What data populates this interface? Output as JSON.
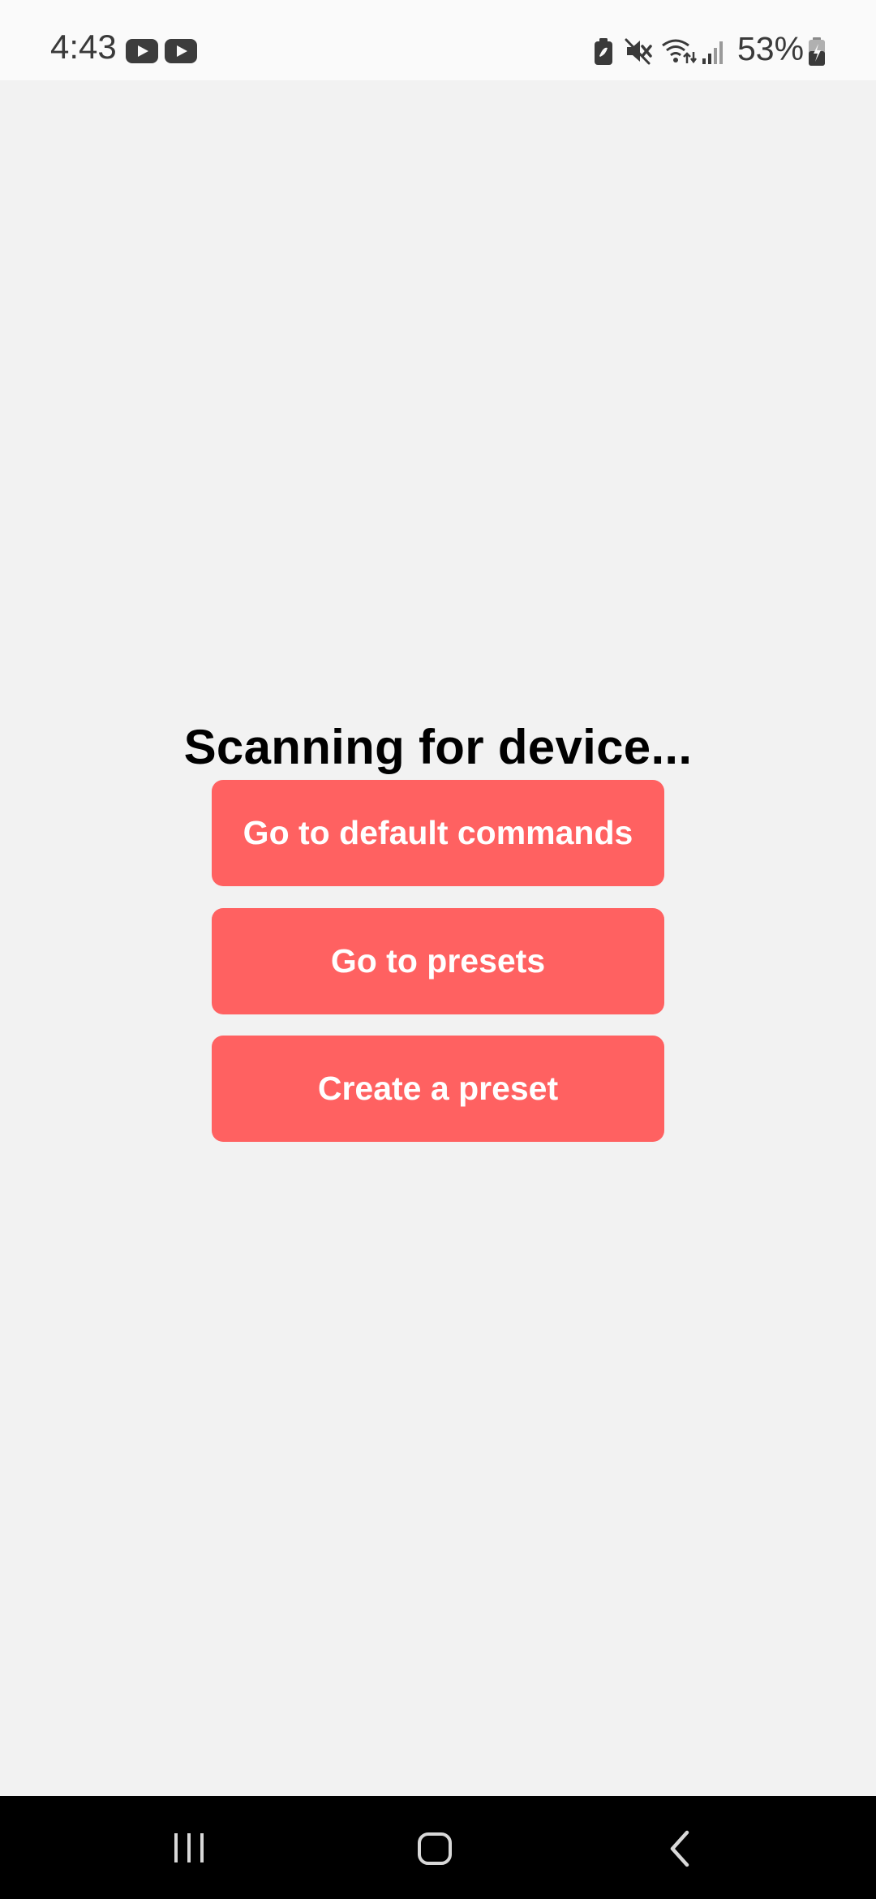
{
  "status_bar": {
    "time": "4:43",
    "notification_icons": [
      "youtube-icon",
      "youtube-icon"
    ],
    "system_icons": [
      "battery-saver-icon",
      "mute-icon",
      "wifi-icon",
      "signal-icon",
      "battery-icon"
    ],
    "battery_percent": "53%"
  },
  "main": {
    "title": "Scanning for device...",
    "buttons": [
      {
        "label": "Go to default commands"
      },
      {
        "label": "Go to presets"
      },
      {
        "label": "Create a preset"
      }
    ]
  },
  "nav_bar": {
    "items": [
      "recent-apps-icon",
      "home-icon",
      "back-icon"
    ]
  },
  "colors": {
    "button_bg": "#ff6161",
    "button_text": "#ffffff",
    "background": "#f2f2f2",
    "title_text": "#000000",
    "nav_bar": "#000000"
  }
}
